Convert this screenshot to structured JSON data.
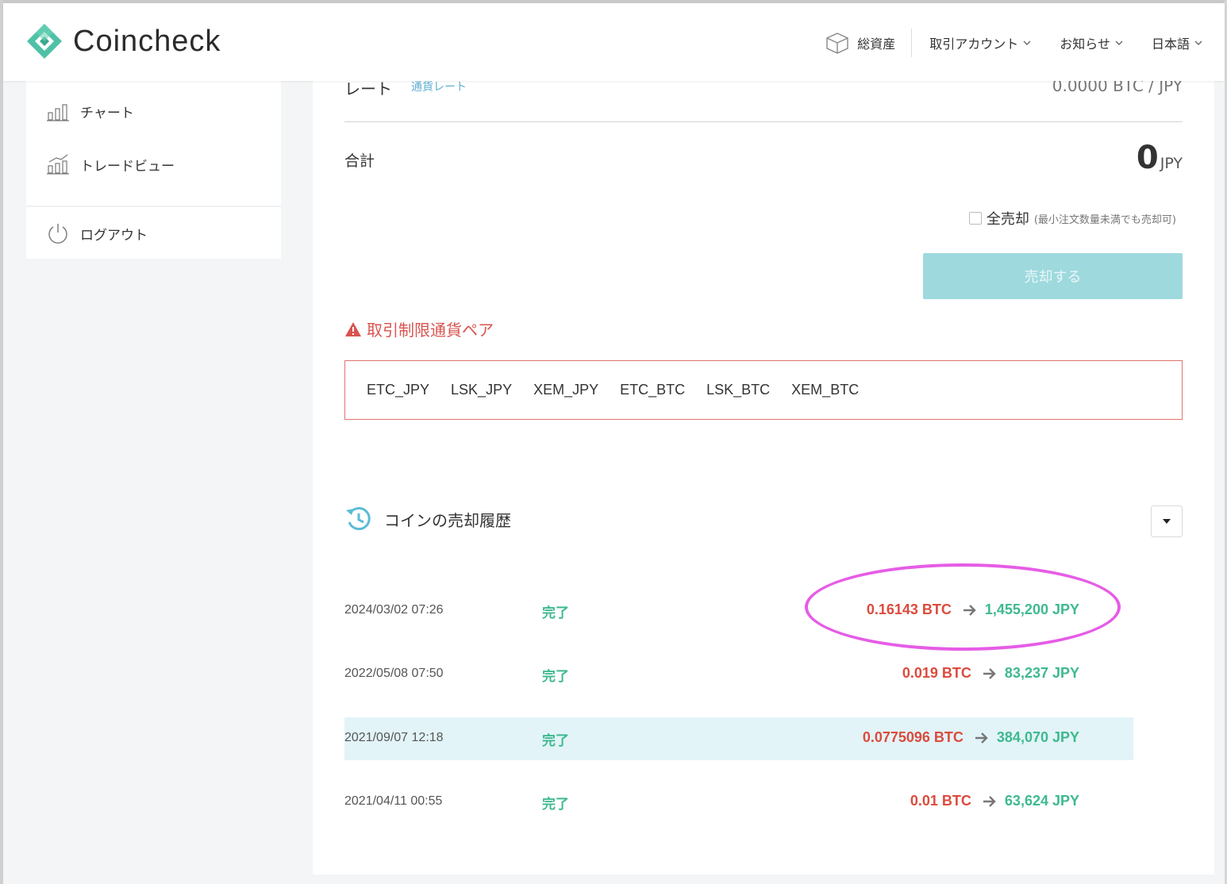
{
  "header": {
    "brand": "Coincheck",
    "nav": {
      "assets": "総資産",
      "account": "取引アカウント",
      "news": "お知らせ",
      "language": "日本語"
    }
  },
  "sidebar": {
    "items": [
      {
        "label": "チャート",
        "icon": "bar-chart-icon"
      },
      {
        "label": "トレードビュー",
        "icon": "trend-chart-icon"
      },
      {
        "label": "ログアウト",
        "icon": "power-icon"
      }
    ]
  },
  "sell": {
    "rate_label": "レート",
    "rate_link": "通貨レート",
    "rate_value": "0.0000  BTC / JPY",
    "total_label": "合計",
    "total_value": "0",
    "total_unit": "JPY",
    "sell_all_label": "全売却",
    "sell_all_note": "(最小注文数量未満でも売却可)",
    "sell_button": "売却する"
  },
  "restricted": {
    "title": "取引制限通貨ペア",
    "pairs": [
      "ETC_JPY",
      "LSK_JPY",
      "XEM_JPY",
      "ETC_BTC",
      "LSK_BTC",
      "XEM_BTC"
    ]
  },
  "history": {
    "title": "コインの売却履歴",
    "rows": [
      {
        "date": "2024/03/02 07:26",
        "status": "完了",
        "btc": "0.16143 BTC",
        "jpy": "1,455,200 JPY"
      },
      {
        "date": "2022/05/08 07:50",
        "status": "完了",
        "btc": "0.019 BTC",
        "jpy": "83,237 JPY"
      },
      {
        "date": "2021/09/07 12:18",
        "status": "完了",
        "btc": "0.0775096 BTC",
        "jpy": "384,070 JPY"
      },
      {
        "date": "2021/04/11 00:55",
        "status": "完了",
        "btc": "0.01 BTC",
        "jpy": "63,624 JPY"
      }
    ]
  },
  "colors": {
    "brand_teal": "#4fc1a6",
    "sell_button": "#9ed9de",
    "warning_red": "#d9534f",
    "btc_red": "#dc4b3d",
    "jpy_green": "#3fb98f",
    "highlight_row": "#e2f4f8",
    "annotation_magenta": "#e65ce6"
  }
}
